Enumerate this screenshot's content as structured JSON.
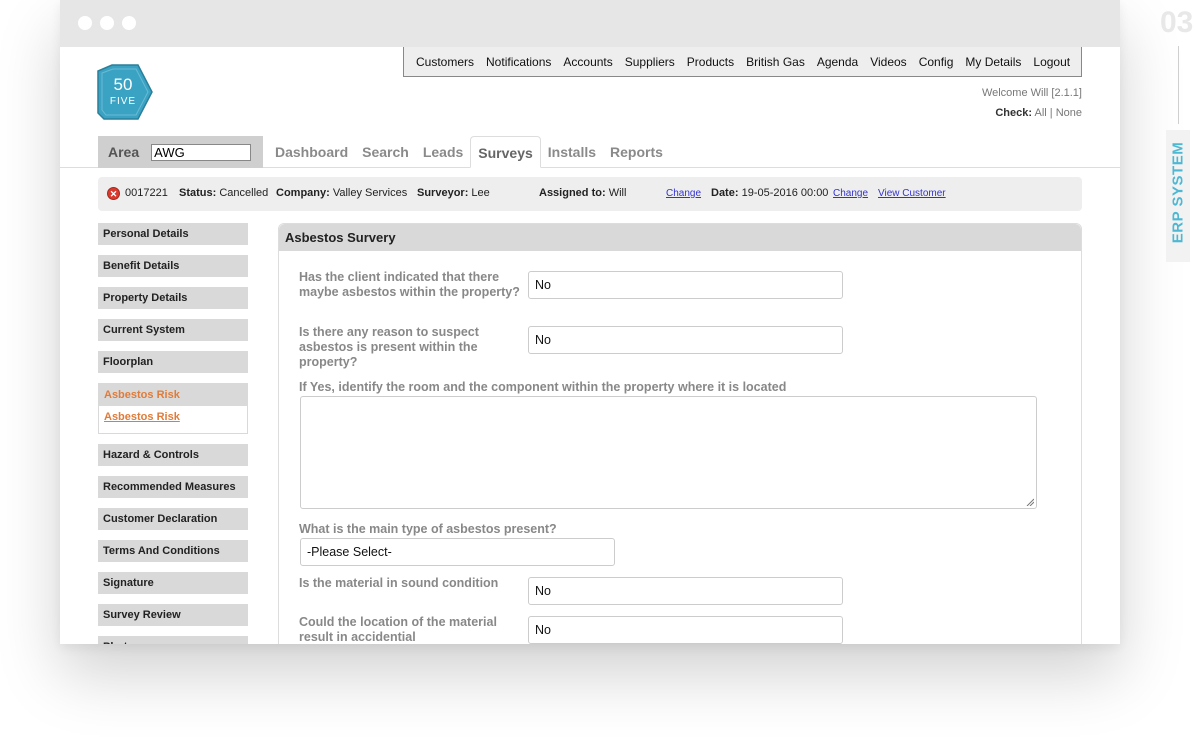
{
  "window": {
    "controls": [
      "close",
      "minimize",
      "maximize"
    ]
  },
  "logo": {
    "line1": "50",
    "line2": "FIVE",
    "color": "#3aa3c4"
  },
  "topmenu": [
    "Customers",
    "Notifications",
    "Accounts",
    "Suppliers",
    "Products",
    "British Gas",
    "Agenda",
    "Videos",
    "Config",
    "My Details",
    "Logout"
  ],
  "welcome": {
    "text": "Welcome Will [2.1.1]",
    "check_label": "Check:",
    "all": "All",
    "sep": "|",
    "none": "None"
  },
  "area": {
    "label": "Area",
    "value": "AWG"
  },
  "tabs": [
    {
      "label": "Dashboard",
      "active": false
    },
    {
      "label": "Search",
      "active": false
    },
    {
      "label": "Leads",
      "active": false
    },
    {
      "label": "Surveys",
      "active": true
    },
    {
      "label": "Installs",
      "active": false
    },
    {
      "label": "Reports",
      "active": false
    }
  ],
  "status": {
    "id": "0017221",
    "status_label": "Status:",
    "status_value": "Cancelled",
    "company_label": "Company:",
    "company_value": "Valley Services",
    "surveyor_label": "Surveyor:",
    "surveyor_value": "Lee",
    "assigned_label": "Assigned to:",
    "assigned_value": "Will",
    "change1": "Change",
    "date_label": "Date:",
    "date_value": "19-05-2016 00:00",
    "change2": "Change",
    "view_customer": "View Customer"
  },
  "sidebar": {
    "items_before": [
      "Personal Details",
      "Benefit Details",
      "Property Details",
      "Current System",
      "Floorplan"
    ],
    "active_group": {
      "label": "Asbestos Risk",
      "sub": "Asbestos Risk"
    },
    "items_after": [
      "Hazard & Controls",
      "Recommended Measures",
      "Customer Declaration",
      "Terms And Conditions",
      "Signature",
      "Survey Review",
      "Photos"
    ]
  },
  "panel": {
    "title": "Asbestos Survery",
    "q1": "Has the client indicated that there maybe asbestos within the property?",
    "a1": "No",
    "q2": "Is there any reason to suspect asbestos is present within the property?",
    "a2": "No",
    "q3": "If Yes, identify the room and the component within the property where it is located",
    "a3": "",
    "q4": "What is the main type of asbestos present?",
    "a4": "-Please Select-",
    "q5": "Is the material in sound condition",
    "a5": "No",
    "q6": "Could the location of the material result in accidential",
    "a6": "No"
  },
  "aside": {
    "number": "03",
    "tag": "ERP SYSTEM",
    "accent": "#4db8d4"
  }
}
